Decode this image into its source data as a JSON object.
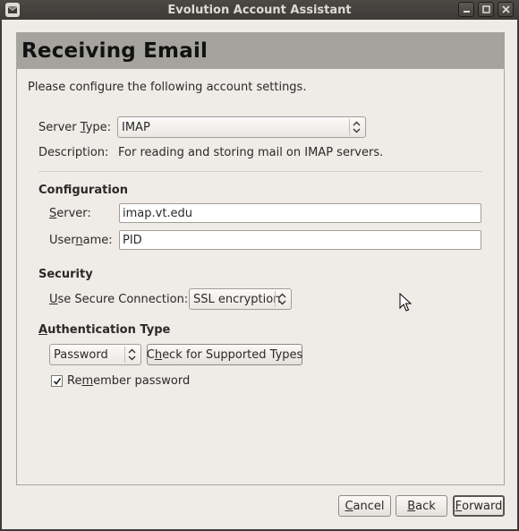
{
  "window": {
    "title": "Evolution Account Assistant",
    "controls": [
      "minimize",
      "maximize",
      "close"
    ]
  },
  "page": {
    "heading": "Receiving Email",
    "intro": "Please configure the following account settings."
  },
  "server_type": {
    "label_pre": "Server ",
    "label_mn": "T",
    "label_post": "ype:",
    "value": "IMAP",
    "description_label": "Description:",
    "description": "For reading and storing mail on IMAP servers."
  },
  "configuration": {
    "title": "Configuration",
    "server_label_mn": "S",
    "server_label_post": "erver:",
    "server_value": "imap.vt.edu",
    "username_label_pre": "User",
    "username_label_mn": "n",
    "username_label_post": "ame:",
    "username_value": "PID"
  },
  "security": {
    "title": "Security",
    "label_mn": "U",
    "label_post": "se Secure Connection:",
    "value": "SSL encryption"
  },
  "authentication": {
    "title_mn": "A",
    "title_post": "uthentication Type",
    "method": "Password",
    "check_pre": "C",
    "check_mn": "h",
    "check_post": "eck for Supported Types",
    "remember_pre": "Re",
    "remember_mn": "m",
    "remember_post": "ember password",
    "remember_checked": true
  },
  "buttons": {
    "cancel_mn": "C",
    "cancel_post": "ancel",
    "back_mn": "B",
    "back_post": "ack",
    "forward_mn": "F",
    "forward_post": "orward"
  }
}
